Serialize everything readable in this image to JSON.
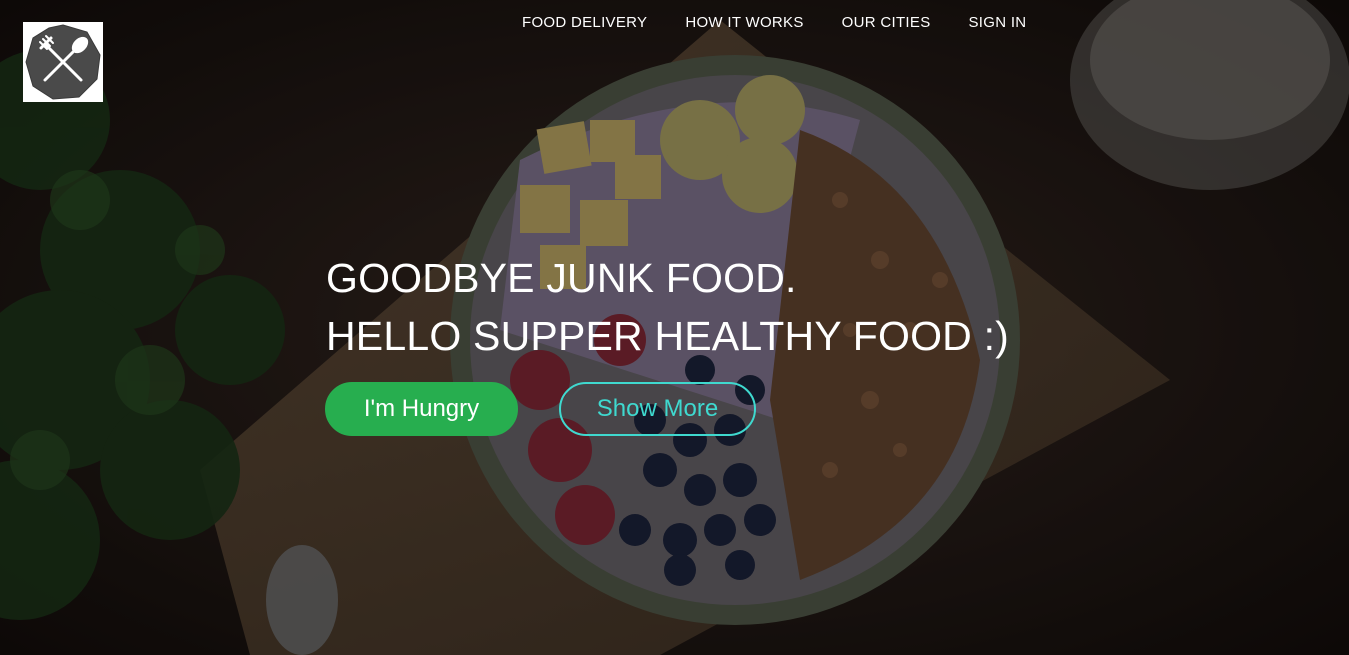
{
  "nav": {
    "items": [
      {
        "label": "FOOD DELIVERY"
      },
      {
        "label": "HOW IT WORKS"
      },
      {
        "label": "OUR CITIES"
      },
      {
        "label": "SIGN IN"
      }
    ]
  },
  "hero": {
    "headline_line1": "GOODBYE JUNK FOOD.",
    "headline_line2": "HELLO SUPPER HEALTHY FOOD :)",
    "primary_button": "I'm Hungry",
    "secondary_button": "Show More"
  },
  "colors": {
    "primary_button_bg": "#27ae4f",
    "secondary_button_accent": "#3fd9cf",
    "text": "#ffffff",
    "logo_badge": "#4a4a4a"
  },
  "icons": {
    "logo": "fork-and-spoon-icon"
  }
}
